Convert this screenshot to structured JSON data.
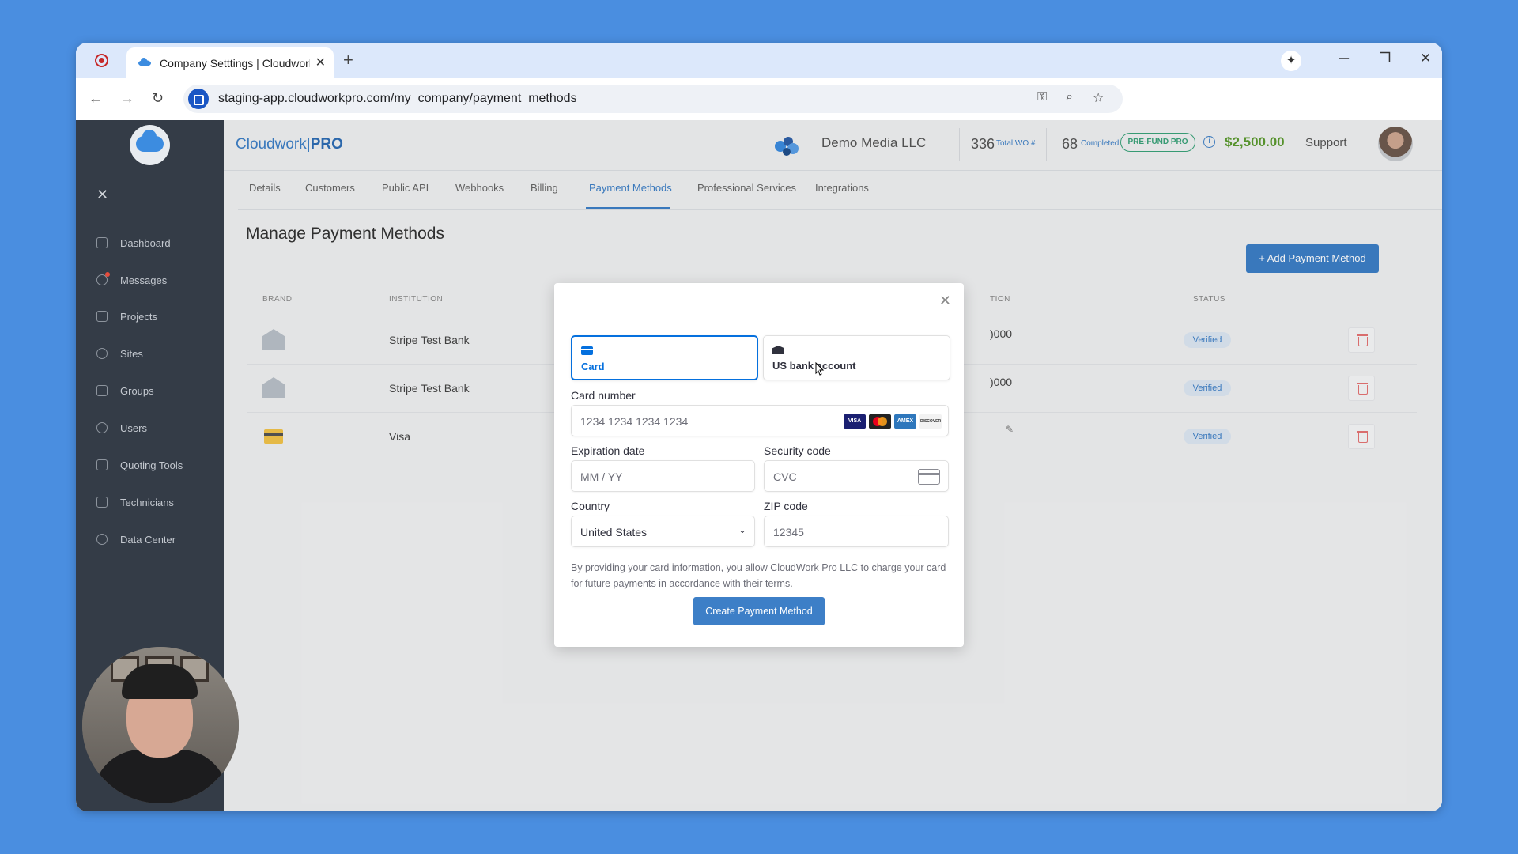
{
  "browser": {
    "tab_title": "Company Setttings | Cloudwork",
    "url": "staging-app.cloudworkpro.com/my_company/payment_methods"
  },
  "sidebar": {
    "items": [
      {
        "label": "Dashboard",
        "icon": "home-icon"
      },
      {
        "label": "Messages",
        "icon": "chat-icon"
      },
      {
        "label": "Projects",
        "icon": "folder-icon"
      },
      {
        "label": "Sites",
        "icon": "location-pin-icon"
      },
      {
        "label": "Groups",
        "icon": "hash-icon"
      },
      {
        "label": "Users",
        "icon": "users-icon"
      },
      {
        "label": "Quoting Tools",
        "icon": "calculator-icon"
      },
      {
        "label": "Technicians",
        "icon": "id-card-icon"
      },
      {
        "label": "Data Center",
        "icon": "pie-chart-icon"
      }
    ]
  },
  "header": {
    "brand_left": "Cloudwork",
    "brand_sep": "|",
    "brand_right": "PRO",
    "company": "Demo Media LLC",
    "total_wo_value": "336",
    "total_wo_label": "Total WO #",
    "completed_value": "68",
    "completed_label": "Completed",
    "prefund": "PRE-FUND PRO",
    "info": "i",
    "amount": "$2,500.00",
    "support": "Support",
    "amount_color": "#5b9a2f",
    "accent_color": "#3d7fc7"
  },
  "subnav": {
    "tabs": [
      "Details",
      "Customers",
      "Public API",
      "Webhooks",
      "Billing",
      "Payment Methods",
      "Professional Services",
      "Integrations"
    ],
    "active": "Payment Methods"
  },
  "page": {
    "title": "Manage Payment Methods",
    "add_button": "+ Add Payment Method"
  },
  "table": {
    "headers": [
      "BRAND",
      "INSTITUTION",
      "TION",
      "STATUS"
    ],
    "rows": [
      {
        "brand_icon": "bank-icon",
        "institution": "Stripe Test Bank",
        "account": ")000",
        "status": "Verified"
      },
      {
        "brand_icon": "bank-icon",
        "institution": "Stripe Test Bank",
        "account": ")000",
        "status": "Verified"
      },
      {
        "brand_icon": "card-icon",
        "institution": "Visa",
        "account": "",
        "status": "Verified"
      }
    ]
  },
  "modal": {
    "tabs": [
      {
        "label": "Card",
        "icon": "card-icon",
        "active": true
      },
      {
        "label": "US bank account",
        "icon": "bank-icon",
        "active": false
      }
    ],
    "card_number_label": "Card number",
    "card_number_placeholder": "1234 1234 1234 1234",
    "card_brands": [
      "VISA",
      "MC",
      "AMEX",
      "DISCOVER"
    ],
    "expiration_label": "Expiration date",
    "expiration_placeholder": "MM / YY",
    "security_label": "Security code",
    "security_placeholder": "CVC",
    "country_label": "Country",
    "country_value": "United States",
    "zip_label": "ZIP code",
    "zip_placeholder": "12345",
    "terms": "By providing your card information, you allow CloudWork Pro LLC to charge your card for future payments in accordance with their terms.",
    "submit": "Create Payment Method",
    "primary_color": "#0570de"
  }
}
